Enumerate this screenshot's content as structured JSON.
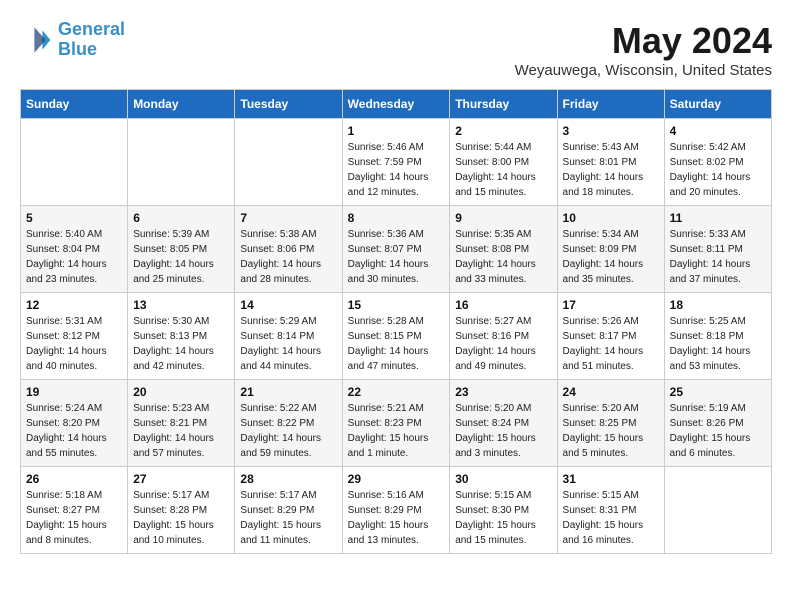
{
  "logo": {
    "line1": "General",
    "line2": "Blue"
  },
  "title": "May 2024",
  "subtitle": "Weyauwega, Wisconsin, United States",
  "weekdays": [
    "Sunday",
    "Monday",
    "Tuesday",
    "Wednesday",
    "Thursday",
    "Friday",
    "Saturday"
  ],
  "weeks": [
    [
      {
        "day": "",
        "info": ""
      },
      {
        "day": "",
        "info": ""
      },
      {
        "day": "",
        "info": ""
      },
      {
        "day": "1",
        "info": "Sunrise: 5:46 AM\nSunset: 7:59 PM\nDaylight: 14 hours\nand 12 minutes."
      },
      {
        "day": "2",
        "info": "Sunrise: 5:44 AM\nSunset: 8:00 PM\nDaylight: 14 hours\nand 15 minutes."
      },
      {
        "day": "3",
        "info": "Sunrise: 5:43 AM\nSunset: 8:01 PM\nDaylight: 14 hours\nand 18 minutes."
      },
      {
        "day": "4",
        "info": "Sunrise: 5:42 AM\nSunset: 8:02 PM\nDaylight: 14 hours\nand 20 minutes."
      }
    ],
    [
      {
        "day": "5",
        "info": "Sunrise: 5:40 AM\nSunset: 8:04 PM\nDaylight: 14 hours\nand 23 minutes."
      },
      {
        "day": "6",
        "info": "Sunrise: 5:39 AM\nSunset: 8:05 PM\nDaylight: 14 hours\nand 25 minutes."
      },
      {
        "day": "7",
        "info": "Sunrise: 5:38 AM\nSunset: 8:06 PM\nDaylight: 14 hours\nand 28 minutes."
      },
      {
        "day": "8",
        "info": "Sunrise: 5:36 AM\nSunset: 8:07 PM\nDaylight: 14 hours\nand 30 minutes."
      },
      {
        "day": "9",
        "info": "Sunrise: 5:35 AM\nSunset: 8:08 PM\nDaylight: 14 hours\nand 33 minutes."
      },
      {
        "day": "10",
        "info": "Sunrise: 5:34 AM\nSunset: 8:09 PM\nDaylight: 14 hours\nand 35 minutes."
      },
      {
        "day": "11",
        "info": "Sunrise: 5:33 AM\nSunset: 8:11 PM\nDaylight: 14 hours\nand 37 minutes."
      }
    ],
    [
      {
        "day": "12",
        "info": "Sunrise: 5:31 AM\nSunset: 8:12 PM\nDaylight: 14 hours\nand 40 minutes."
      },
      {
        "day": "13",
        "info": "Sunrise: 5:30 AM\nSunset: 8:13 PM\nDaylight: 14 hours\nand 42 minutes."
      },
      {
        "day": "14",
        "info": "Sunrise: 5:29 AM\nSunset: 8:14 PM\nDaylight: 14 hours\nand 44 minutes."
      },
      {
        "day": "15",
        "info": "Sunrise: 5:28 AM\nSunset: 8:15 PM\nDaylight: 14 hours\nand 47 minutes."
      },
      {
        "day": "16",
        "info": "Sunrise: 5:27 AM\nSunset: 8:16 PM\nDaylight: 14 hours\nand 49 minutes."
      },
      {
        "day": "17",
        "info": "Sunrise: 5:26 AM\nSunset: 8:17 PM\nDaylight: 14 hours\nand 51 minutes."
      },
      {
        "day": "18",
        "info": "Sunrise: 5:25 AM\nSunset: 8:18 PM\nDaylight: 14 hours\nand 53 minutes."
      }
    ],
    [
      {
        "day": "19",
        "info": "Sunrise: 5:24 AM\nSunset: 8:20 PM\nDaylight: 14 hours\nand 55 minutes."
      },
      {
        "day": "20",
        "info": "Sunrise: 5:23 AM\nSunset: 8:21 PM\nDaylight: 14 hours\nand 57 minutes."
      },
      {
        "day": "21",
        "info": "Sunrise: 5:22 AM\nSunset: 8:22 PM\nDaylight: 14 hours\nand 59 minutes."
      },
      {
        "day": "22",
        "info": "Sunrise: 5:21 AM\nSunset: 8:23 PM\nDaylight: 15 hours\nand 1 minute."
      },
      {
        "day": "23",
        "info": "Sunrise: 5:20 AM\nSunset: 8:24 PM\nDaylight: 15 hours\nand 3 minutes."
      },
      {
        "day": "24",
        "info": "Sunrise: 5:20 AM\nSunset: 8:25 PM\nDaylight: 15 hours\nand 5 minutes."
      },
      {
        "day": "25",
        "info": "Sunrise: 5:19 AM\nSunset: 8:26 PM\nDaylight: 15 hours\nand 6 minutes."
      }
    ],
    [
      {
        "day": "26",
        "info": "Sunrise: 5:18 AM\nSunset: 8:27 PM\nDaylight: 15 hours\nand 8 minutes."
      },
      {
        "day": "27",
        "info": "Sunrise: 5:17 AM\nSunset: 8:28 PM\nDaylight: 15 hours\nand 10 minutes."
      },
      {
        "day": "28",
        "info": "Sunrise: 5:17 AM\nSunset: 8:29 PM\nDaylight: 15 hours\nand 11 minutes."
      },
      {
        "day": "29",
        "info": "Sunrise: 5:16 AM\nSunset: 8:29 PM\nDaylight: 15 hours\nand 13 minutes."
      },
      {
        "day": "30",
        "info": "Sunrise: 5:15 AM\nSunset: 8:30 PM\nDaylight: 15 hours\nand 15 minutes."
      },
      {
        "day": "31",
        "info": "Sunrise: 5:15 AM\nSunset: 8:31 PM\nDaylight: 15 hours\nand 16 minutes."
      },
      {
        "day": "",
        "info": ""
      }
    ]
  ]
}
